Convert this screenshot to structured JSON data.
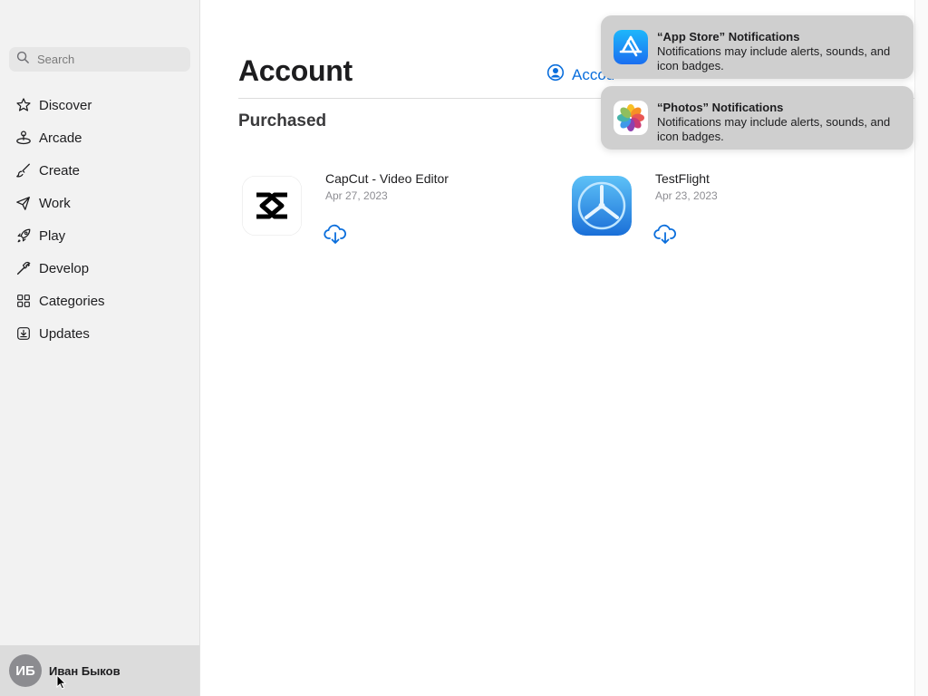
{
  "sidebar": {
    "search": {
      "placeholder": "Search",
      "icon": "magnifying-glass"
    },
    "items": [
      {
        "label": "Discover",
        "icon": "star"
      },
      {
        "label": "Arcade",
        "icon": "joystick"
      },
      {
        "label": "Create",
        "icon": "paintbrush"
      },
      {
        "label": "Work",
        "icon": "paper-plane"
      },
      {
        "label": "Play",
        "icon": "rocket"
      },
      {
        "label": "Develop",
        "icon": "hammer"
      },
      {
        "label": "Categories",
        "icon": "grid"
      },
      {
        "label": "Updates",
        "icon": "download-tray"
      }
    ],
    "profile": {
      "initials": "ИБ",
      "name": "Иван Быков"
    }
  },
  "main": {
    "title": "Account",
    "account_settings_label": "Accou",
    "section_title": "Purchased",
    "apps": [
      {
        "name": "CapCut - Video Editor",
        "date": "Apr 27, 2023",
        "icon": "capcut"
      },
      {
        "name": "TestFlight",
        "date": "Apr 23, 2023",
        "icon": "testflight"
      }
    ]
  },
  "notifications": [
    {
      "title": "“App Store” Notifications",
      "body": "Notifications may include alerts, sounds, and icon badges.",
      "icon": "app-store"
    },
    {
      "title": "“Photos” Notifications",
      "body": "Notifications may include alerts, sounds, and icon badges.",
      "icon": "photos"
    }
  ],
  "colors": {
    "accent": "#0a6edc",
    "sidebar_bg": "#f2f2f2",
    "notification_bg": "#cfcfcf"
  }
}
